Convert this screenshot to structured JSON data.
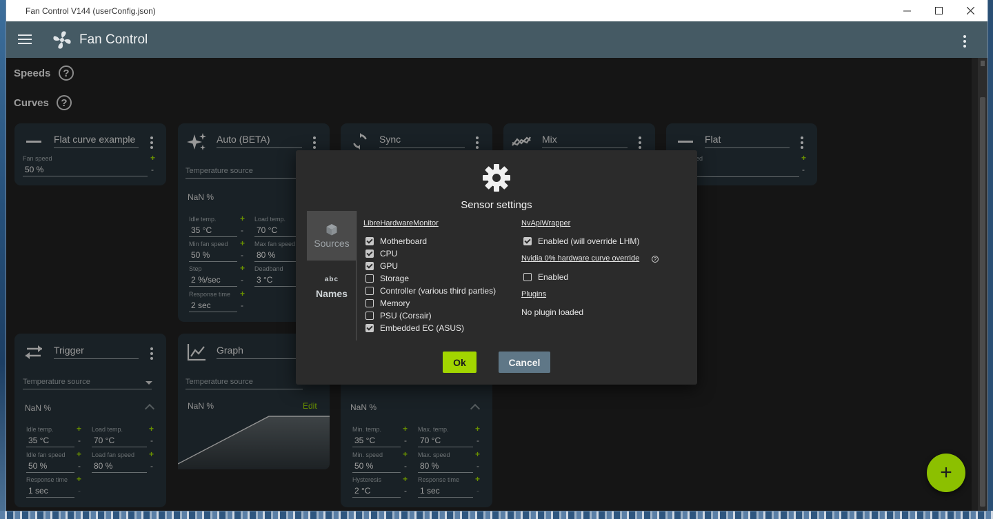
{
  "window": {
    "title": "Fan Control V144 (userConfig.json)"
  },
  "app": {
    "title": "Fan Control"
  },
  "sections": {
    "speeds": "Speeds",
    "curves": "Curves",
    "help_glyph": "?"
  },
  "cards": {
    "flat_example": {
      "title": "Flat curve example",
      "fan_speed_label": "Fan speed",
      "fan_speed": "50 %"
    },
    "auto": {
      "title": "Auto (BETA)",
      "source": "Temperature source",
      "nan": "NaN %",
      "idle_temp_label": "Idle temp.",
      "idle_temp": "35 °C",
      "load_temp_label": "Load temp.",
      "load_temp": "70 °C",
      "min_fan_label": "Min fan speed",
      "min_fan": "50 %",
      "max_fan_label": "Max fan speed",
      "max_fan": "80 %",
      "step_label": "Step",
      "step": "2 %/sec",
      "deadband_label": "Deadband",
      "deadband": "3 °C",
      "response_label": "Response time",
      "response": "2 sec"
    },
    "sync": {
      "title": "Sync"
    },
    "mix": {
      "title": "Mix"
    },
    "flat": {
      "title": "Flat",
      "fan_speed_label_partial": "ed"
    },
    "trigger": {
      "title": "Trigger",
      "source": "Temperature source",
      "nan": "NaN %",
      "idle_temp_label": "Idle temp.",
      "idle_temp": "35 °C",
      "load_temp_label": "Load temp.",
      "load_temp": "70 °C",
      "idle_fan_label": "Idle fan speed",
      "idle_fan": "50 %",
      "load_fan_label": "Load fan speed",
      "load_fan": "80 %",
      "response_label": "Response time",
      "response": "1 sec"
    },
    "graph": {
      "title": "Graph",
      "source": "Temperature source",
      "nan": "NaN %",
      "edit": "Edit"
    },
    "linear": {
      "nan": "NaN %",
      "min_temp_label": "Min. temp.",
      "min_temp": "35 °C",
      "max_temp_label": "Max. temp.",
      "max_temp": "70 °C",
      "min_speed_label": "Min. speed",
      "min_speed": "50 %",
      "max_speed_label": "Max. speed",
      "max_speed": "80 %",
      "hysteresis_label": "Hysteresis",
      "hysteresis": "2 °C",
      "response_label": "Response time",
      "response": "1 sec"
    }
  },
  "signs": {
    "plus": "+",
    "minus": "-"
  },
  "dialog": {
    "title": "Sensor settings",
    "nav": {
      "sources": "Sources",
      "names": "Names",
      "names_glyph": "abc"
    },
    "lhm": {
      "header": "LibreHardwareMonitor",
      "items": [
        {
          "label": "Motherboard",
          "checked": true
        },
        {
          "label": "CPU",
          "checked": true
        },
        {
          "label": "GPU",
          "checked": true
        },
        {
          "label": "Storage",
          "checked": false
        },
        {
          "label": "Controller (various third parties)",
          "checked": false
        },
        {
          "label": "Memory",
          "checked": false
        },
        {
          "label": "PSU (Corsair)",
          "checked": false
        },
        {
          "label": "Embedded EC (ASUS)",
          "checked": true
        }
      ]
    },
    "nvapi": {
      "header": "NvApiWrapper",
      "enabled_label": "Enabled (will override LHM)",
      "enabled": true,
      "override_header": "Nvidia 0% hardware curve override",
      "override_enabled_label": "Enabled",
      "override_enabled": false
    },
    "plugins": {
      "header": "Plugins",
      "status": "No plugin loaded"
    },
    "ok": "Ok",
    "cancel": "Cancel"
  },
  "fab": {
    "glyph": "+"
  }
}
